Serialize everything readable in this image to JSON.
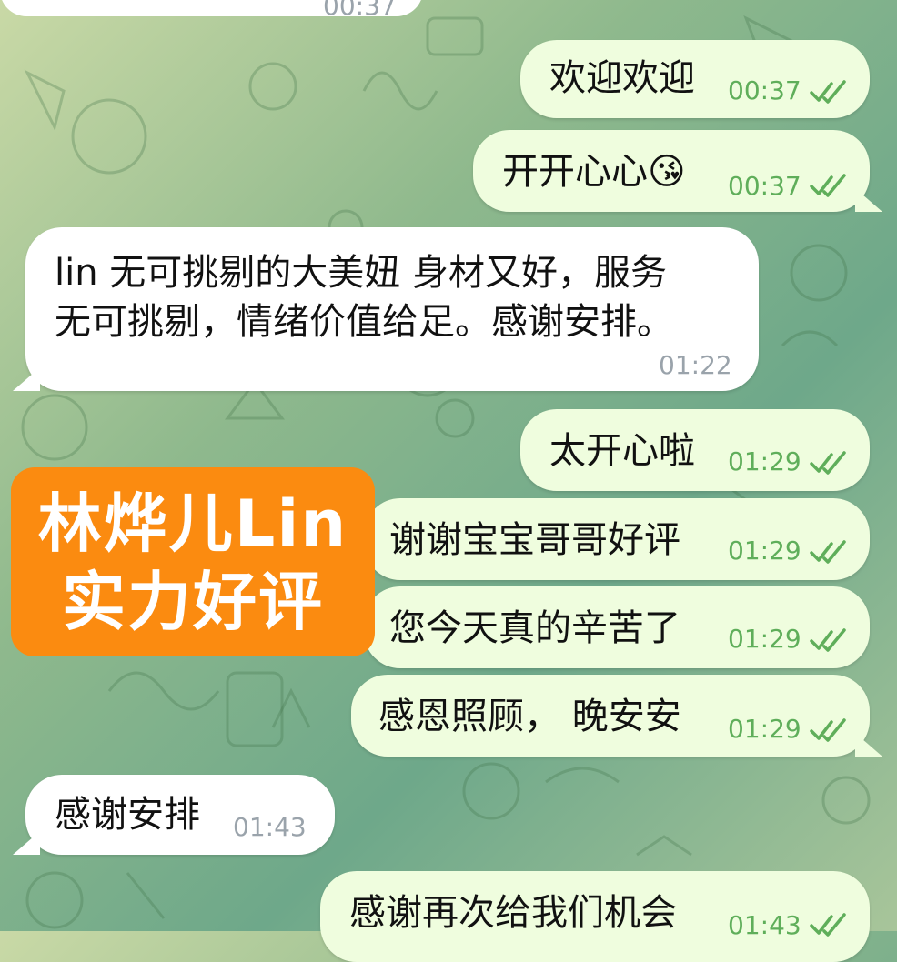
{
  "colors": {
    "incoming_bubble": "#ffffff",
    "outgoing_bubble": "#effdde",
    "outgoing_time": "#5fae5a",
    "incoming_time": "#9aa3ab",
    "badge": "#fb8b10"
  },
  "top_partial": {
    "time": "00:37"
  },
  "messages": [
    {
      "direction": "out",
      "text": "欢迎欢迎",
      "time": "00:37",
      "status": "read"
    },
    {
      "direction": "out",
      "text": "开开心心",
      "emoji": "😘",
      "time": "00:37",
      "status": "read"
    },
    {
      "direction": "in",
      "lines": [
        "lin 无可挑剔的大美妞 身材又好，服务",
        "无可挑剔，情绪价值给足。感谢安排。"
      ],
      "time": "01:22"
    },
    {
      "direction": "out",
      "text": "太开心啦",
      "time": "01:29",
      "status": "read"
    },
    {
      "direction": "out",
      "text": "谢谢宝宝哥哥好评",
      "time": "01:29",
      "status": "read"
    },
    {
      "direction": "out",
      "text": "您今天真的辛苦了",
      "time": "01:29",
      "status": "read"
    },
    {
      "direction": "out",
      "text": "感恩照顾， 晚安安",
      "time": "01:29",
      "status": "read"
    },
    {
      "direction": "in",
      "text": "感谢安排",
      "time": "01:43"
    },
    {
      "direction": "out",
      "text": "感谢再次给我们机会",
      "time": "01:43",
      "status": "read"
    }
  ],
  "badge": {
    "line1": "林烨儿Lin",
    "line2": "实力好评"
  }
}
